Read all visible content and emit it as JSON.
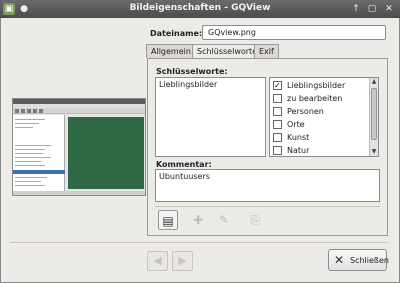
{
  "titlebar": {
    "title": "Bildeigenschaften - GQView",
    "app_icon": "gqview-app-icon",
    "menu_icon": "window-menu-icon",
    "buttons": [
      "up-arrow-icon",
      "maximize-icon",
      "close-icon"
    ]
  },
  "form": {
    "dateiname_label": "Dateiname:",
    "dateiname_value": "GQview.png"
  },
  "tabs": [
    {
      "label": "Allgemein",
      "active": false
    },
    {
      "label": "Schlüsselworte",
      "active": true
    },
    {
      "label": "Exif",
      "active": false
    }
  ],
  "keywords_panel": {
    "label": "Schlüsselworte:",
    "text": "Lieblingsbilder",
    "list": [
      {
        "label": "Lieblingsbilder",
        "checked": true
      },
      {
        "label": "zu bearbeiten",
        "checked": false
      },
      {
        "label": "Personen",
        "checked": false
      },
      {
        "label": "Orte",
        "checked": false
      },
      {
        "label": "Kunst",
        "checked": false
      },
      {
        "label": "Natur",
        "checked": false
      }
    ],
    "scroll_up_icon": "scroll-up-arrow-icon",
    "scroll_down_icon": "scroll-down-arrow-icon"
  },
  "comment": {
    "label": "Kommentar:",
    "text": "Ubuntuusers"
  },
  "toolbar": {
    "icons": [
      "keyword-list-icon",
      "add-icon",
      "edit-icon",
      "paste-icon"
    ]
  },
  "footer": {
    "prev_icon": "back-arrow-icon",
    "next_icon": "forward-arrow-icon",
    "close_label": "Schließen",
    "close_icon": "close-x-icon"
  },
  "colors": {
    "titlebar": "#4b4b4b",
    "preview_background": "#2f6844",
    "selection": "#3d6fb5"
  }
}
